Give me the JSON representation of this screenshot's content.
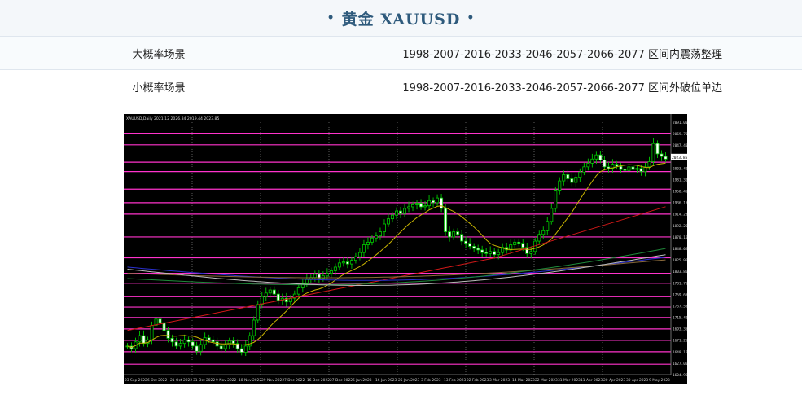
{
  "header": {
    "dot_left": "•",
    "title": "黄金 XAUUSD",
    "dot_right": "•"
  },
  "scenarios": [
    {
      "label": "大概率场景",
      "value": "1998-2007-2016-2033-2046-2057-2066-2077 区间内震荡整理"
    },
    {
      "label": "小概率场景",
      "value": "1998-2007-2016-2033-2046-2057-2066-2077 区间外破位单边"
    }
  ],
  "chart": {
    "header_text": "XAUUSD,Daily  2021.12 2026.84 2019.44 2023.85",
    "price_labels": [
      "2091.00",
      "2069.70",
      "2047.40",
      "2025.85",
      "2003.40",
      "1981.30",
      "1958.45",
      "1936.15",
      "1914.23",
      "1892.25",
      "1870.15",
      "1848.02",
      "1825.95",
      "1803.85",
      "1781.75",
      "1759.65",
      "1737.55",
      "1715.42",
      "1693.35",
      "1671.25",
      "1649.15",
      "1627.05",
      "1604.95"
    ],
    "date_labels": [
      "23 Sep 2022",
      "6 Oct 2022",
      "21 Oct 2022",
      "31 Oct 2022",
      "9 Nov 2022",
      "18 Nov 2022",
      "29 Nov 2022",
      "7 Dec 2022",
      "16 Dec 2022",
      "27 Dec 2022",
      "6 Jan 2023",
      "16 Jan 2023",
      "25 Jan 2023",
      "3 Feb 2023",
      "13 Feb 2023",
      "22 Feb 2023",
      "3 Mar 2023",
      "14 Mar 2023",
      "22 Mar 2023",
      "31 Mar 2023",
      "11 Apr 2023",
      "20 Apr 2023",
      "30 Apr 2023",
      "9 May 2023"
    ],
    "current_price": "2023.85",
    "colors": {
      "bg": "#000000",
      "candle": "#00cc00",
      "level": "#ff33cc",
      "ma_fast": "#c8b400",
      "ma_mid": "#d01818",
      "ma_slow": "#2a30d0",
      "ma_long": "#8a6a3a",
      "ma_green": "#1f8a3a",
      "ma_white": "#bbbbbb"
    }
  }
}
